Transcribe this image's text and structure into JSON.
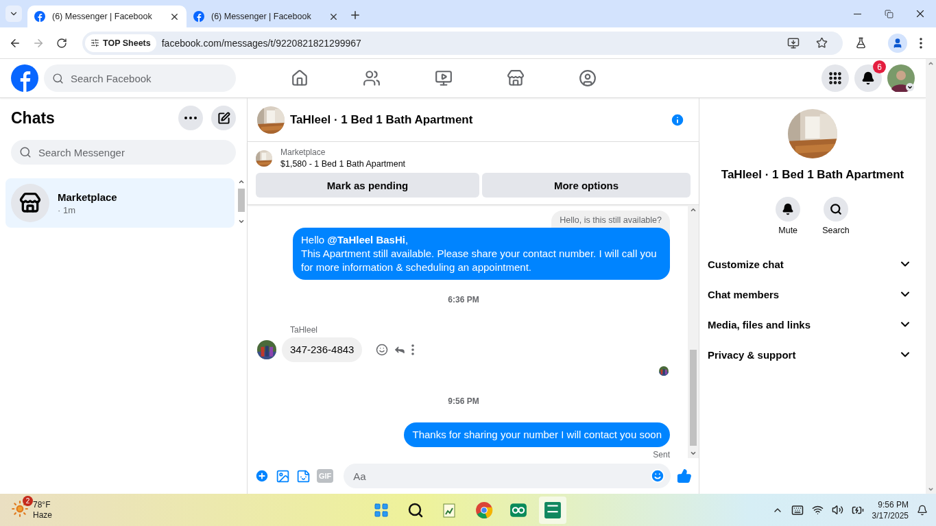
{
  "browser": {
    "tabs": [
      {
        "title": "(6) Messenger | Facebook",
        "selected": true
      },
      {
        "title": "(6) Messenger | Facebook",
        "selected": false
      }
    ],
    "address": {
      "chip": "TOP Sheets",
      "url": "facebook.com/messages/t/9220821821299967"
    }
  },
  "header": {
    "search": {
      "placeholder": "Search Facebook"
    },
    "notification_count": "6"
  },
  "chats": {
    "title": "Chats",
    "search": {
      "placeholder": "Search Messenger"
    },
    "items": [
      {
        "name": "Marketplace",
        "meta": "· 1m",
        "selected": true
      }
    ]
  },
  "conversation": {
    "title": "TaHleel · 1 Bed 1 Bath Apartment",
    "listing": {
      "source": "Marketplace",
      "title": "$1,580 - 1 Bed 1 Bath Apartment"
    },
    "buttons": [
      "Mark as pending",
      "More options"
    ],
    "messages": [
      {
        "kind": "preset",
        "text": "Hello, is this still available?"
      },
      {
        "kind": "sent",
        "text": "Hello **@TaHleel BasHi**,\nThis Apartment still available. Please share your contact number. I will call you for more information & scheduling an appointment."
      },
      {
        "kind": "time",
        "text": "6:36 PM"
      },
      {
        "kind": "received",
        "sender": "TaHleel",
        "text": "347-236-4843"
      },
      {
        "kind": "seen"
      },
      {
        "kind": "time",
        "text": "9:56 PM"
      },
      {
        "kind": "sent",
        "text": "Thanks for sharing your number I will contact you soon",
        "status": "Sent"
      }
    ],
    "composer": {
      "placeholder": "Aa",
      "gif": "GIF"
    }
  },
  "details": {
    "title": "TaHleel · 1 Bed 1 Bath Apartment",
    "actions": [
      {
        "kind": "mute",
        "label": "Mute"
      },
      {
        "kind": "search",
        "label": "Search"
      }
    ],
    "sections": [
      "Customize chat",
      "Chat members",
      "Media, files and links",
      "Privacy & support"
    ]
  },
  "taskbar": {
    "weather": {
      "badge": "2",
      "temp": "78°F",
      "condition": "Haze"
    },
    "clock": {
      "time": "9:56 PM",
      "date": "3/17/2025"
    }
  }
}
